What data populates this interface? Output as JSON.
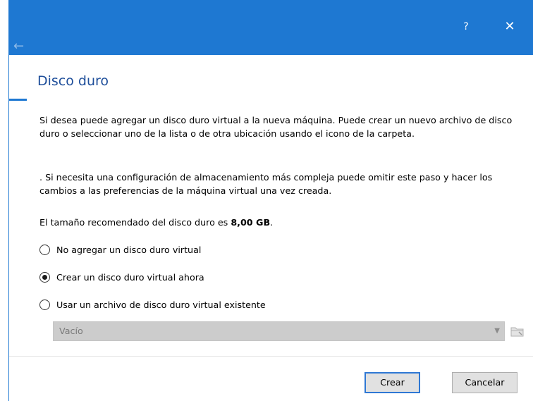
{
  "titlebar": {
    "help_label": "?",
    "close_label": "✕",
    "back_label": "←"
  },
  "page": {
    "title": "Disco duro",
    "intro_text": "Si desea puede agregar un disco duro virtual a la nueva máquina. Puede crear un nuevo archivo de disco duro o seleccionar uno de la lista o de otra ubicación usando el icono de la carpeta.",
    "advanced_text": ". Si necesita una configuración de almacenamiento más compleja puede omitir este paso y hacer los cambios a las preferencias de la máquina virtual una vez creada.",
    "recommended_prefix": "El tamaño recomendado del disco duro es ",
    "recommended_size": "8,00 GB",
    "recommended_suffix": "."
  },
  "options": [
    {
      "label": "No agregar un disco duro virtual",
      "selected": false
    },
    {
      "label": "Crear un disco duro virtual ahora",
      "selected": true
    },
    {
      "label": "Usar un archivo de disco duro virtual existente",
      "selected": false
    }
  ],
  "disk_select": {
    "value": "Vacío",
    "disabled": true
  },
  "buttons": {
    "create": "Crear",
    "cancel": "Cancelar"
  },
  "colors": {
    "accent": "#1e78d2",
    "title_text": "#1e4e9a",
    "disabled_field": "#cccccc"
  },
  "icons": {
    "back": "arrow-left-icon",
    "help": "help-icon",
    "close": "close-icon",
    "dropdown": "chevron-down-icon",
    "folder": "folder-icon"
  }
}
